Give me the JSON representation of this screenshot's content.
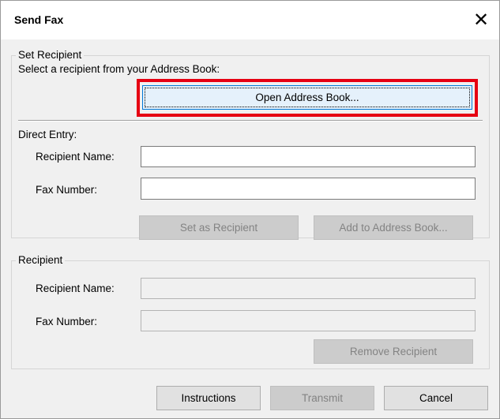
{
  "window": {
    "title": "Send Fax",
    "close_glyph": "✕"
  },
  "set_recipient": {
    "group_label": "Set Recipient",
    "instruction": "Select a recipient from your Address Book:",
    "open_address_book_label": "Open Address Book...",
    "highlight_color": "#e60012"
  },
  "direct_entry": {
    "label": "Direct Entry:",
    "recipient_name_label": "Recipient Name:",
    "recipient_name_value": "",
    "fax_number_label": "Fax Number:",
    "fax_number_value": "",
    "set_as_recipient_label": "Set as Recipient",
    "add_to_address_book_label": "Add to Address Book..."
  },
  "recipient": {
    "group_label": "Recipient",
    "recipient_name_label": "Recipient Name:",
    "recipient_name_value": "",
    "fax_number_label": "Fax Number:",
    "fax_number_value": "",
    "remove_recipient_label": "Remove Recipient"
  },
  "footer": {
    "instructions_label": "Instructions",
    "transmit_label": "Transmit",
    "cancel_label": "Cancel"
  }
}
